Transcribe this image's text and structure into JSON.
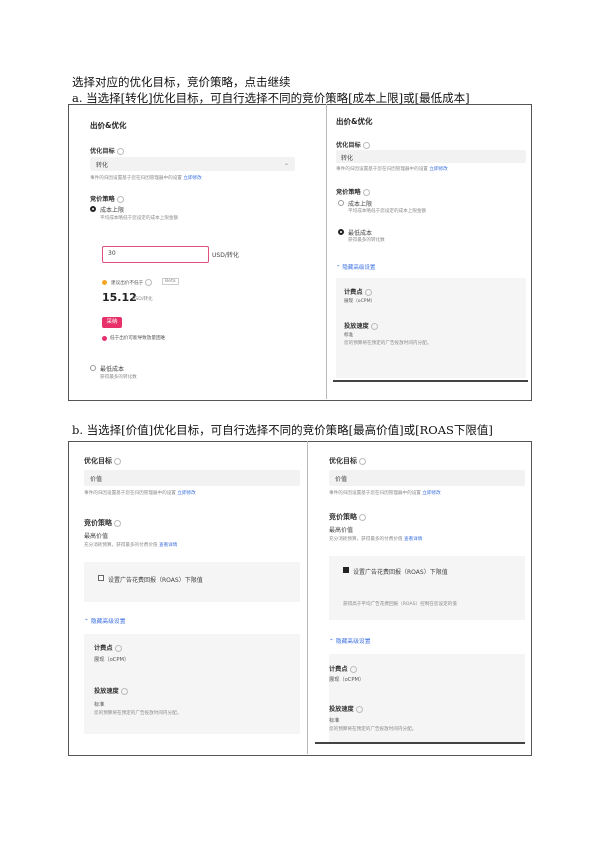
{
  "doc": {
    "intro": "选择对应的优化目标，竞价策略，点击继续",
    "section_a": "a. 当选择[转化]优化目标，可自行选择不同的竞价策略[成本上限]或[最低成本]",
    "section_b": "b. 当选择[价值]优化目标，可自行选择不同的竞价策略[最高价值]或[ROAS下限值]"
  },
  "a_left": {
    "title": "出价&优化",
    "goal_label": "优化目标",
    "goal_value": "转化",
    "goal_hint": "事件的归因设置基于您在归因管理器中的设置",
    "goal_hint_link": "立即修改",
    "bid_label": "竞价策略",
    "opt1": "成本上限",
    "opt1_desc": "平均成本略低于您设定的成本上限金额",
    "input_value": "30",
    "input_unit": "USD/转化",
    "suggest_label": "建议出价不低于",
    "suggest_badge": "Beta",
    "suggest_value": "15.12",
    "suggest_unit": "USD/转化",
    "apply_btn": "采纳",
    "warn": "低于出价可能导致放量困难",
    "opt2": "最低成本",
    "opt2_desc": "获得最多的转化数"
  },
  "a_right": {
    "title": "出价&优化",
    "goal_label": "优化目标",
    "goal_value": "转化",
    "goal_hint": "事件的归因设置基于您在归因管理器中的设置",
    "goal_hint_link": "立即修改",
    "bid_label": "竞价策略",
    "opt1": "成本上限",
    "opt1_desc": "平均成本略低于您设定的成本上限金额",
    "opt2": "最低成本",
    "opt2_desc": "获得最多的转化数",
    "advanced": "隐藏高级设置",
    "billing_label": "计费点",
    "billing_value": "展现（oCPM）",
    "pace_label": "投放速度",
    "pace_value": "标准",
    "pace_desc": "您的预算将在预定的广告投放时间内分配。"
  },
  "b_left": {
    "goal_label": "优化目标",
    "goal_value": "价值",
    "goal_hint": "事件的归因设置基于您在归因管理器中的设置",
    "goal_hint_link": "立即修改",
    "bid_label": "竞价策略",
    "bid_value": "最高价值",
    "bid_desc": "充分消耗预算，获得最多的付费价值",
    "bid_desc_link": "查看详情",
    "roas_check": "设置广告花费回报（ROAS）下限值",
    "advanced": "隐藏高级设置",
    "billing_label": "计费点",
    "billing_value": "展现（oCPM）",
    "pace_label": "投放速度",
    "pace_value": "标准",
    "pace_desc": "您的预算将在预定的广告投放时间内分配。"
  },
  "b_right": {
    "goal_label": "优化目标",
    "goal_value": "价值",
    "goal_hint": "事件的归因设置基于您在归因管理器中的设置",
    "goal_hint_link": "立即修改",
    "bid_label": "竞价策略",
    "bid_value": "最高价值",
    "bid_desc": "充分消耗预算，获得最多的付费价值",
    "bid_desc_link": "查看详情",
    "roas_check": "设置广告花费回报（ROAS）下限值",
    "roas_hint": "获得高于平均广告花费回报（ROAS）控制在您设定的值",
    "advanced": "隐藏高级设置",
    "billing_label": "计费点",
    "billing_value": "展现（oCPM）",
    "pace_label": "投放速度",
    "pace_value": "标准",
    "pace_desc": "您的预算将在预定的广告投放时间内分配。"
  },
  "colors": {
    "accent_pink": "#e8316a",
    "link_blue": "#3b6fe0",
    "frame": "#555555"
  }
}
